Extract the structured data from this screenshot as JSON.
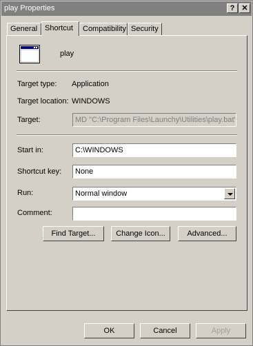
{
  "window": {
    "title": "play Properties",
    "help_button": "?",
    "close_button": "✕"
  },
  "tabs": [
    "General",
    "Shortcut",
    "Compatibility",
    "Security"
  ],
  "active_tab": "Shortcut",
  "shortcut": {
    "name": "play",
    "target_type_label": "Target type:",
    "target_type_value": "Application",
    "target_location_label": "Target location:",
    "target_location_value": "WINDOWS",
    "target_label": "Target:",
    "target_value": "MD \"C:\\Program Files\\Launchy\\Utilities\\play.bat\"",
    "start_in_label": "Start in:",
    "start_in_value": "C:\\WINDOWS",
    "shortcut_key_label": "Shortcut key:",
    "shortcut_key_value": "None",
    "run_label": "Run:",
    "run_value": "Normal window",
    "comment_label": "Comment:",
    "comment_value": ""
  },
  "buttons": {
    "find_target": "Find Target...",
    "change_icon": "Change Icon...",
    "advanced": "Advanced...",
    "ok": "OK",
    "cancel": "Cancel",
    "apply": "Apply"
  },
  "icons": {
    "app": "application-window-icon",
    "dropdown": "chevron-down-icon"
  }
}
